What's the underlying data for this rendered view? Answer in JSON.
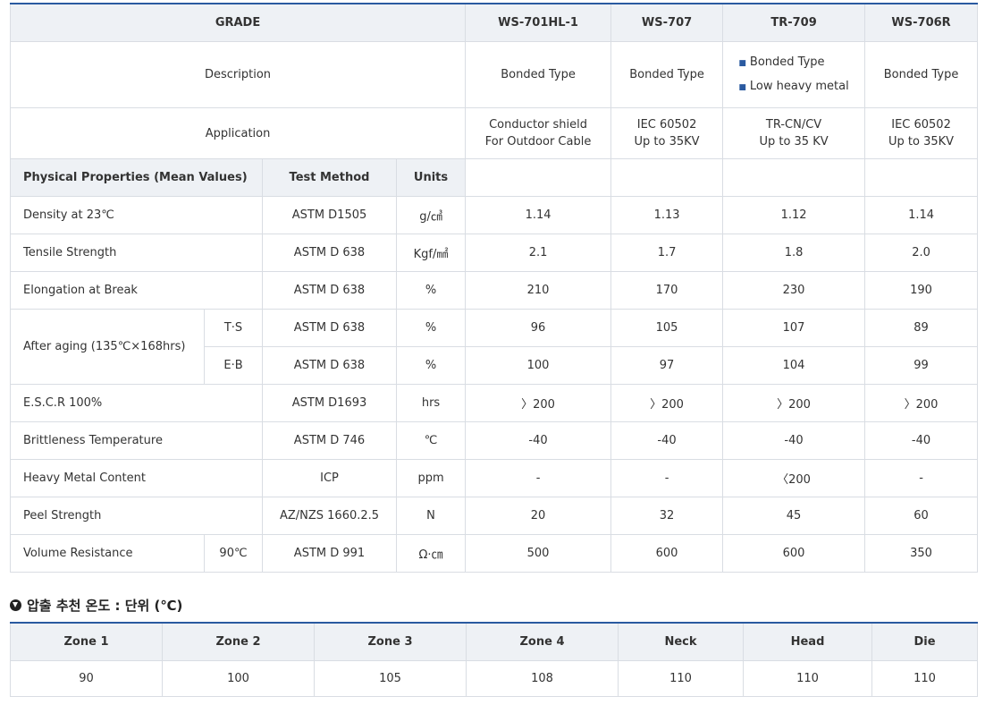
{
  "spec": {
    "grade_label": "GRADE",
    "grades": [
      "WS-701HL-1",
      "WS-707",
      "TR-709",
      "WS-706R"
    ],
    "description_label": "Description",
    "descriptions": {
      "g1": "Bonded Type",
      "g2": "Bonded Type",
      "g3_line1": "Bonded Type",
      "g3_line2": "Low heavy metal",
      "g4": "Bonded Type"
    },
    "application_label": "Application",
    "applications": [
      [
        "Conductor shield",
        "For Outdoor Cable"
      ],
      [
        "IEC 60502",
        "Up to 35KV"
      ],
      [
        "TR-CN/CV",
        "Up to 35 KV"
      ],
      [
        "IEC 60502",
        "Up to 35KV"
      ]
    ],
    "sub_headers": {
      "properties": "Physical Properties (Mean Values)",
      "test_method": "Test Method",
      "units": "Units"
    },
    "rows": [
      {
        "property": "Density at 23℃",
        "method": "ASTM D1505",
        "units": "g/㎤",
        "values": [
          "1.14",
          "1.13",
          "1.12",
          "1.14"
        ]
      },
      {
        "property": "Tensile Strength",
        "method": "ASTM D 638",
        "units": "Kgf/㎟",
        "values": [
          "2.1",
          "1.7",
          "1.8",
          "2.0"
        ]
      },
      {
        "property": "Elongation at Break",
        "method": "ASTM D 638",
        "units": "%",
        "values": [
          "210",
          "170",
          "230",
          "190"
        ]
      },
      {
        "property": "After aging (135℃×168hrs)",
        "sub": "T·S",
        "method": "ASTM D 638",
        "units": "%",
        "values": [
          "96",
          "105",
          "107",
          "89"
        ]
      },
      {
        "sub": "E·B",
        "method": "ASTM D 638",
        "units": "%",
        "values": [
          "100",
          "97",
          "104",
          "99"
        ]
      },
      {
        "property": "E.S.C.R 100%",
        "method": "ASTM D1693",
        "units": "hrs",
        "values": [
          "〉200",
          "〉200",
          "〉200",
          "〉200"
        ]
      },
      {
        "property": "Brittleness Temperature",
        "method": "ASTM D 746",
        "units": "℃",
        "values": [
          "-40",
          "-40",
          "-40",
          "-40"
        ]
      },
      {
        "property": "Heavy Metal Content",
        "method": "ICP",
        "units": "ppm",
        "values": [
          "-",
          "-",
          "〈200",
          "-"
        ]
      },
      {
        "property": "Peel Strength",
        "method": "AZ/NZS 1660.2.5",
        "units": "N",
        "values": [
          "20",
          "32",
          "45",
          "60"
        ]
      },
      {
        "property": "Volume Resistance",
        "sub": "90℃",
        "method": "ASTM D 991",
        "units": "Ω·㎝",
        "values": [
          "500",
          "600",
          "600",
          "350"
        ]
      }
    ]
  },
  "extrusion": {
    "heading": "압출 추천 온도 : 단위 (℃)",
    "icon": "download-circle-icon",
    "headers": [
      "Zone 1",
      "Zone 2",
      "Zone 3",
      "Zone 4",
      "Neck",
      "Head",
      "Die"
    ],
    "values": [
      "90",
      "100",
      "105",
      "108",
      "110",
      "110",
      "110"
    ]
  },
  "colors": {
    "accent": "#2a5aa0",
    "header_bg": "#eef1f5",
    "border": "#d9dde3"
  }
}
